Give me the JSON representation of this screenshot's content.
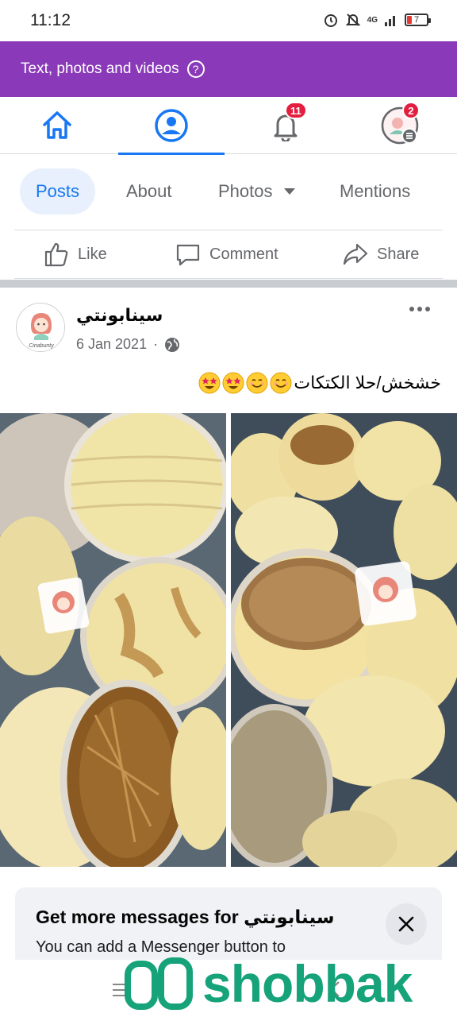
{
  "status_bar": {
    "time": "11:12",
    "network_label": "4G",
    "battery_level": "7"
  },
  "banner": {
    "text": "Text, photos and videos",
    "help_icon": "?"
  },
  "top_nav": {
    "tabs": [
      {
        "name": "home",
        "icon": "home-icon",
        "active": false
      },
      {
        "name": "profile",
        "icon": "profile-icon",
        "active": true
      },
      {
        "name": "notifications",
        "icon": "bell-icon",
        "badge": "11"
      },
      {
        "name": "menu",
        "icon": "avatar-menu-icon",
        "badge": "2"
      }
    ]
  },
  "sub_tabs": {
    "items": [
      "Posts",
      "About",
      "Photos",
      "Mentions"
    ],
    "active": "Posts"
  },
  "actions": {
    "like": "Like",
    "comment": "Comment",
    "share": "Share"
  },
  "post": {
    "author": "سينابونتي",
    "date": "6 Jan 2021",
    "separator": "·",
    "privacy_icon": "globe-icon",
    "text": "خشخش/حلا الكتكات",
    "emojis": [
      "smiling-face-icon",
      "smiling-face-icon",
      "star-struck-icon",
      "star-struck-icon"
    ],
    "logo_text": "Cinabunty"
  },
  "messenger_card": {
    "title_prefix": "Get more messages for",
    "title_name": "سينابونتي",
    "body": "You can add a Messenger button to"
  },
  "watermark": {
    "text": "shobbak"
  },
  "colors": {
    "banner": "#8a3ab9",
    "accent": "#1877f2",
    "badge": "#e41e3f",
    "watermark": "#16a37a"
  }
}
